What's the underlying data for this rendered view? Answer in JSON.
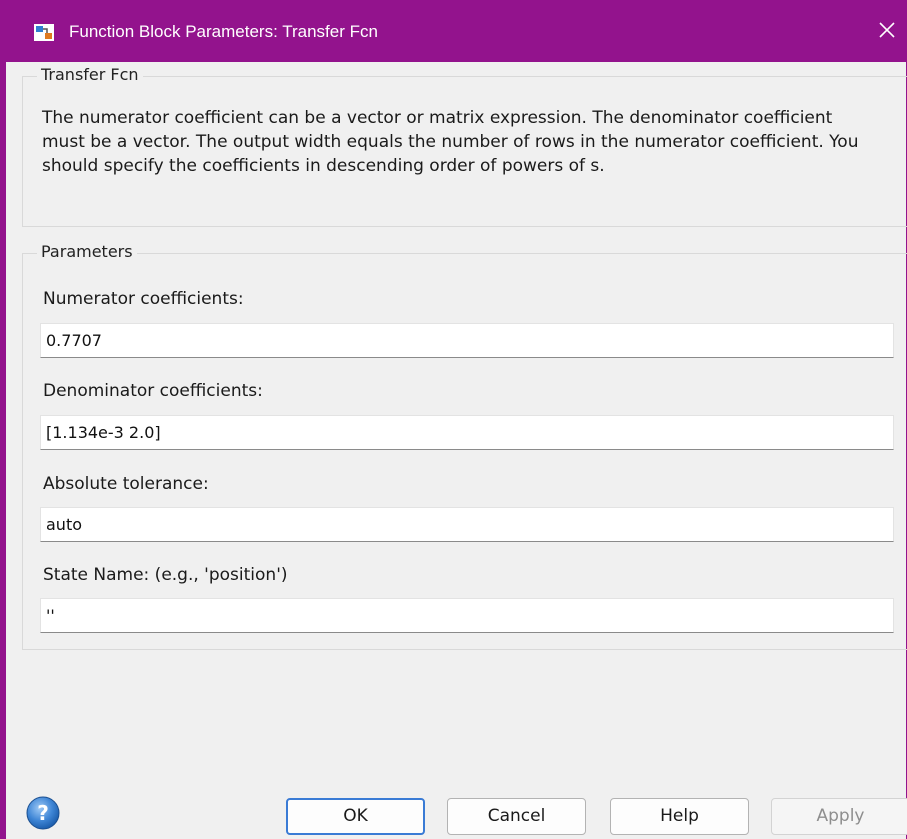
{
  "window": {
    "title": "Function Block Parameters: Transfer Fcn",
    "accent_color": "#93138d"
  },
  "block_group": {
    "legend": "Transfer Fcn",
    "description": "The numerator coefficient can be a vector or matrix expression. The denominator coefficient must be a vector. The output width equals the number of rows in the numerator coefficient. You should specify the coefficients in descending order of powers of s."
  },
  "parameters": {
    "legend": "Parameters",
    "numerator": {
      "label": "Numerator coefficients:",
      "value": "0.7707"
    },
    "denominator": {
      "label": "Denominator coefficients:",
      "value": "[1.134e-3 2.0]"
    },
    "abs_tol": {
      "label": "Absolute tolerance:",
      "value": "auto"
    },
    "state_name": {
      "label": "State Name: (e.g., 'position')",
      "value": "''"
    }
  },
  "buttons": {
    "ok": "OK",
    "cancel": "Cancel",
    "help": "Help",
    "apply": "Apply"
  },
  "icons": {
    "app": "simulink-block-icon",
    "close": "close-icon",
    "help": "help-icon"
  }
}
